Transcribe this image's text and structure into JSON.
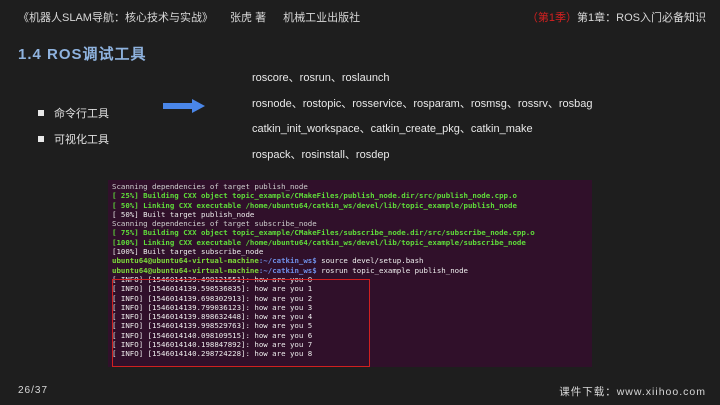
{
  "header": {
    "book_title": "《机器人SLAM导航：核心技术与实战》",
    "author": "张虎 著",
    "publisher": "机械工业出版社",
    "season": "（第1季）",
    "chapter": "第1章：ROS入门必备知识"
  },
  "section_title": "1.4  ROS调试工具",
  "bullets": [
    "命令行工具",
    "可视化工具"
  ],
  "commands": [
    "roscore、rosrun、roslaunch",
    "rosnode、rostopic、rosservice、rosparam、rosmsg、rossrv、rosbag",
    "catkin_init_workspace、catkin_create_pkg、catkin_make",
    "rospack、rosinstall、rosdep"
  ],
  "terminal": {
    "lines": [
      {
        "style": "gray",
        "text": "Scanning dependencies of target publish_node"
      },
      {
        "style": "green",
        "text": "[ 25%] Building CXX object topic_example/CMakeFiles/publish_node.dir/src/publish_node.cpp.o"
      },
      {
        "style": "green",
        "text": "[ 50%] Linking CXX executable /home/ubuntu64/catkin_ws/devel/lib/topic_example/publish_node"
      },
      {
        "style": "white",
        "text": "[ 50%] Built target publish_node"
      },
      {
        "style": "gray",
        "text": "Scanning dependencies of target subscribe_node"
      },
      {
        "style": "green",
        "text": "[ 75%] Building CXX object topic_example/CMakeFiles/subscribe_node.dir/src/subscribe_node.cpp.o"
      },
      {
        "style": "green",
        "text": "[100%] Linking CXX executable /home/ubuntu64/catkin_ws/devel/lib/topic_example/subscribe_node"
      },
      {
        "style": "white",
        "text": "[100%] Built target subscribe_node"
      },
      {
        "style": "prompt",
        "user": "ubuntu64@ubuntu64-virtual-machine",
        "path": ":~/catkin_ws$",
        "cmd": " source devel/setup.bash"
      },
      {
        "style": "prompt",
        "user": "ubuntu64@ubuntu64-virtual-machine",
        "path": ":~/catkin_ws$",
        "cmd": " rosrun topic_example publish_node"
      },
      {
        "style": "white",
        "text": "[ INFO] [1546014139.498121551]: how are you 0"
      },
      {
        "style": "white",
        "text": "[ INFO] [1546014139.598536835]: how are you 1"
      },
      {
        "style": "white",
        "text": "[ INFO] [1546014139.698302913]: how are you 2"
      },
      {
        "style": "white",
        "text": "[ INFO] [1546014139.799036123]: how are you 3"
      },
      {
        "style": "white",
        "text": "[ INFO] [1546014139.898632448]: how are you 4"
      },
      {
        "style": "white",
        "text": "[ INFO] [1546014139.998529763]: how are you 5"
      },
      {
        "style": "white",
        "text": "[ INFO] [1546014140.098109515]: how are you 6"
      },
      {
        "style": "white",
        "text": "[ INFO] [1546014140.198847892]: how are you 7"
      },
      {
        "style": "white",
        "text": "[ INFO] [1546014140.298724228]: how are you 8"
      }
    ]
  },
  "footer": {
    "page": "26/37",
    "download": "课件下载：www.xiihoo.com"
  }
}
